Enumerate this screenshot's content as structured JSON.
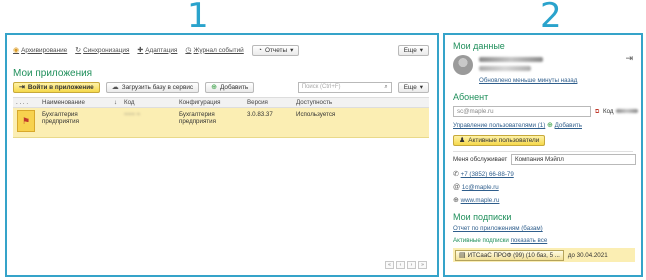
{
  "labels": {
    "panel1": "1",
    "panel2": "2"
  },
  "toolbar": {
    "archive": "Архивирование",
    "sync": "Синхронизация",
    "adapt": "Адаптация",
    "journal": "Журнал событий",
    "reports": "Отчеты",
    "more": "Еще"
  },
  "apps": {
    "title": "Мои приложения",
    "login_btn": "Войти в приложение",
    "upload_btn": "Загрузить базу в сервис",
    "add_btn": "Добавить",
    "search_placeholder": "Поиск (Ctrl+F)",
    "more": "Еще",
    "columns": {
      "dots": ". . . .",
      "name": "Наименование",
      "sort": "↓",
      "code": "Код",
      "config": "Конфигурация",
      "version": "Версия",
      "availability": "Доступность"
    },
    "row": {
      "name_line1": "Бухгалтерия",
      "name_line2": "предприятия",
      "code": "~~~ ~",
      "config_line1": "Бухгалтерия",
      "config_line2": "предприятия",
      "version": "3.0.83.37",
      "availability": "Используется"
    },
    "pager": [
      "«",
      "‹",
      "›",
      "»"
    ]
  },
  "profile": {
    "title": "Мои данные",
    "updated": "Обновлено меньше минуты назад",
    "subscriber_title": "Абонент",
    "subscriber_value": "sc@maple.ru",
    "code_label": "Код",
    "manage_users": "Управление пользователями (1)",
    "add_label": "Добавить",
    "active_users_btn": "Активные пользователи",
    "serves_label": "Меня обслуживает",
    "serves_value": "Компания Мэйпл",
    "phone": "+7 (3852) 66-88-79",
    "email": "1c@maple.ru",
    "site": "www.maple.ru"
  },
  "subscriptions": {
    "title": "Мои подписки",
    "report_link": "Отчет по приложениям (базам)",
    "active_label": "Активные подписки",
    "show_all": "показать все",
    "item": "ИТСааС ПРОФ (99) (10 баз, 5 ...",
    "item_until": "до 30.04.2021"
  },
  "colors": {
    "frame": "#35a3c9",
    "accent_green": "#1f8f5b",
    "row_highlight": "#fbeeb3"
  }
}
